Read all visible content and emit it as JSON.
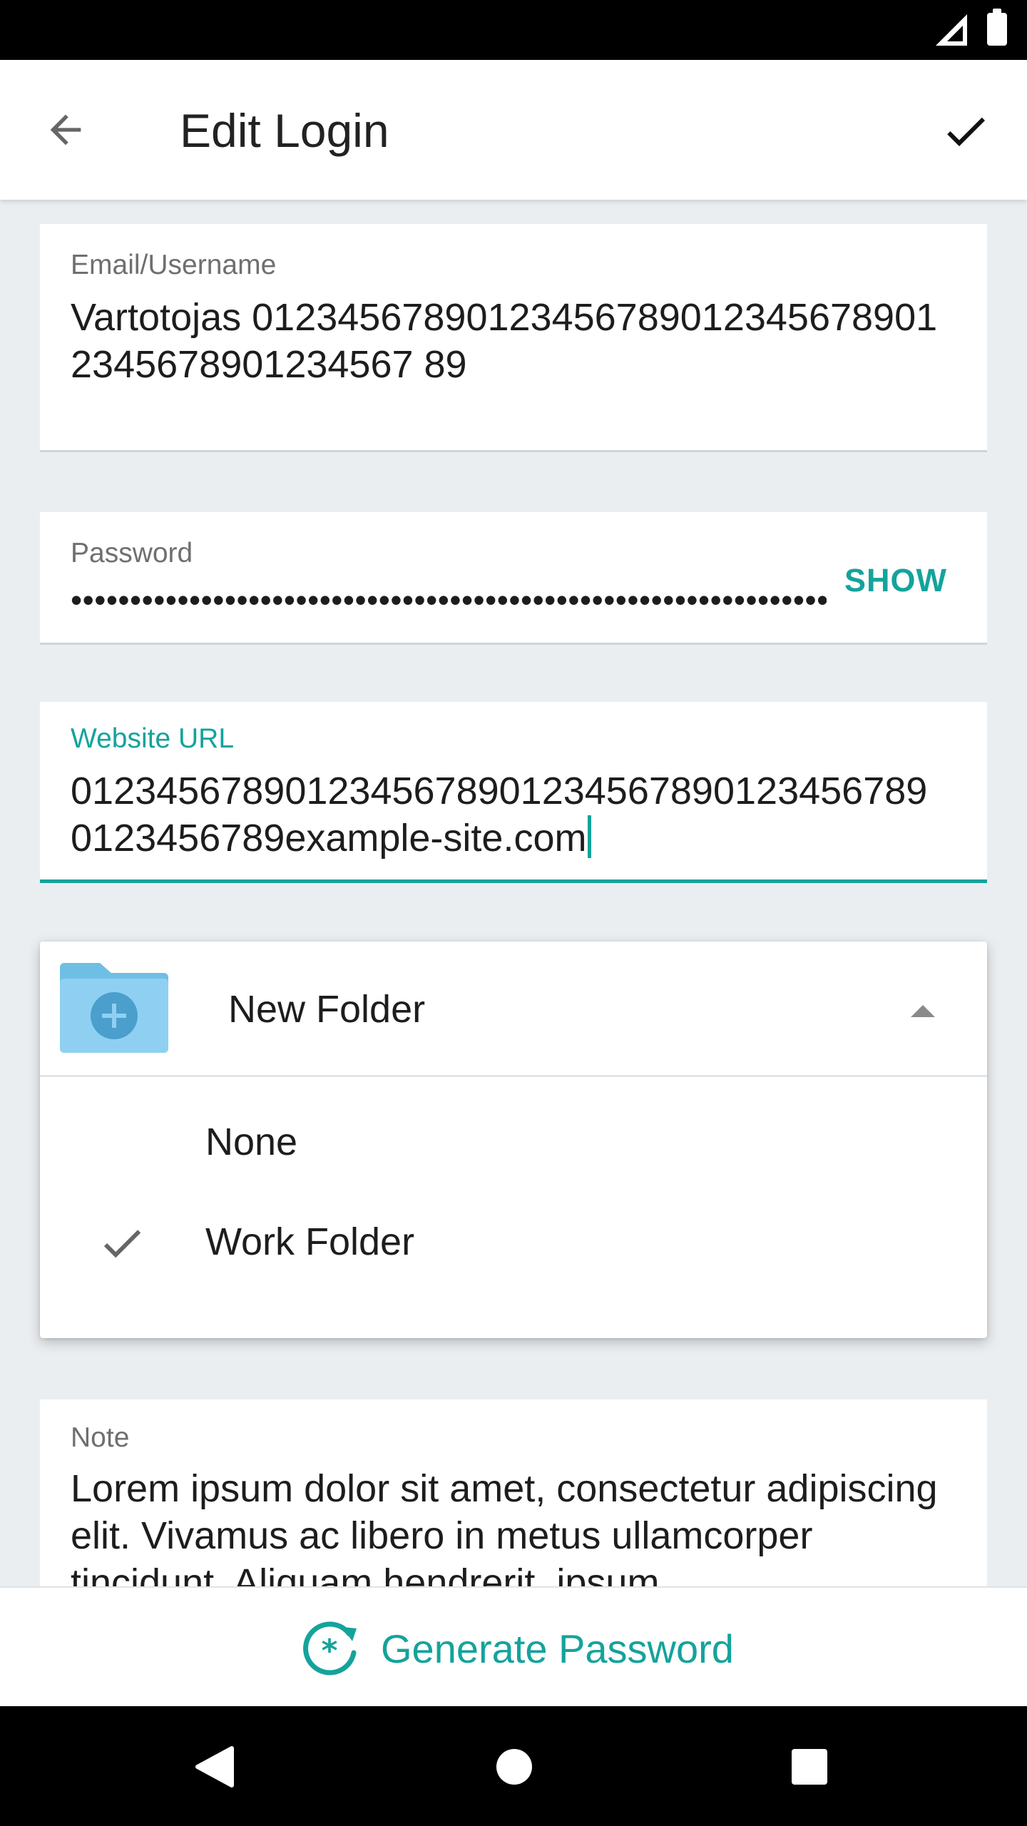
{
  "app_bar": {
    "title": "Edit Login",
    "back_icon": "arrow-back-icon",
    "save_icon": "check-icon"
  },
  "form": {
    "email": {
      "label": "Email/Username",
      "value": "Vartotojas 012345678901234567890123456789012345678901234567 89"
    },
    "password": {
      "label": "Password",
      "masked_value": "••••••••••••••••••••••••••••••••••••••••••••••••••••••••••••••••••••••••••••••••••••",
      "show_label": "SHOW"
    },
    "website": {
      "label": "Website URL",
      "value": "01234567890123456789012345678901234567890123456789example-site.com"
    },
    "note": {
      "label": "Note",
      "value": "Lorem ipsum dolor sit amet, consectetur adipiscing elit. Vivamus ac libero in metus ullamcorper tincidunt. Aliquam hendrerit, ipsum"
    }
  },
  "folder_dropdown": {
    "selected_label": "New Folder",
    "options": [
      {
        "label": "None",
        "checked": false
      },
      {
        "label": "Work Folder",
        "checked": true
      }
    ]
  },
  "bottom_action": {
    "label": "Generate Password"
  },
  "colors": {
    "accent": "#14a39b",
    "background": "#ebeef1",
    "folder_blue": "#8fd0f2"
  }
}
